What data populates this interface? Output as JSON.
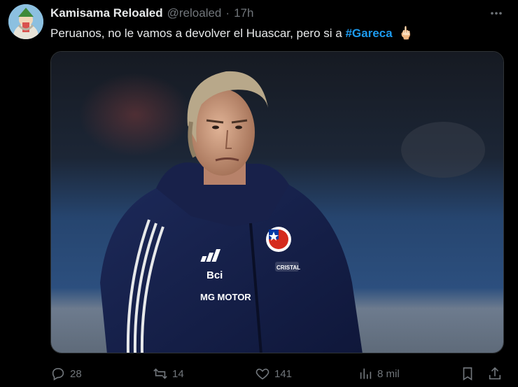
{
  "author": {
    "display_name": "Kamisama Reloaled",
    "handle": "@reloaled",
    "separator": "·",
    "time": "17h"
  },
  "tweet": {
    "text": "Peruanos, no le vamos a devolver el Huascar, pero si a",
    "hashtag": "#Gareca",
    "emoji": "🖕🏻"
  },
  "media": {
    "jacket_texts": {
      "sponsor_bci": "Bci",
      "sponsor_mg": "MG MOTOR",
      "sponsor_cristal": "CRISTAL"
    }
  },
  "actions": {
    "replies": "28",
    "reposts": "14",
    "likes": "141",
    "views": "8 mil"
  },
  "icons": {
    "more": "more-icon",
    "reply": "reply-icon",
    "repost": "repost-icon",
    "like": "heart-icon",
    "views": "views-icon",
    "bookmark": "bookmark-icon",
    "share": "share-icon"
  },
  "colors": {
    "background": "#000000",
    "text": "#e7e9ea",
    "muted": "#71767b",
    "accent": "#1d9bf0"
  }
}
